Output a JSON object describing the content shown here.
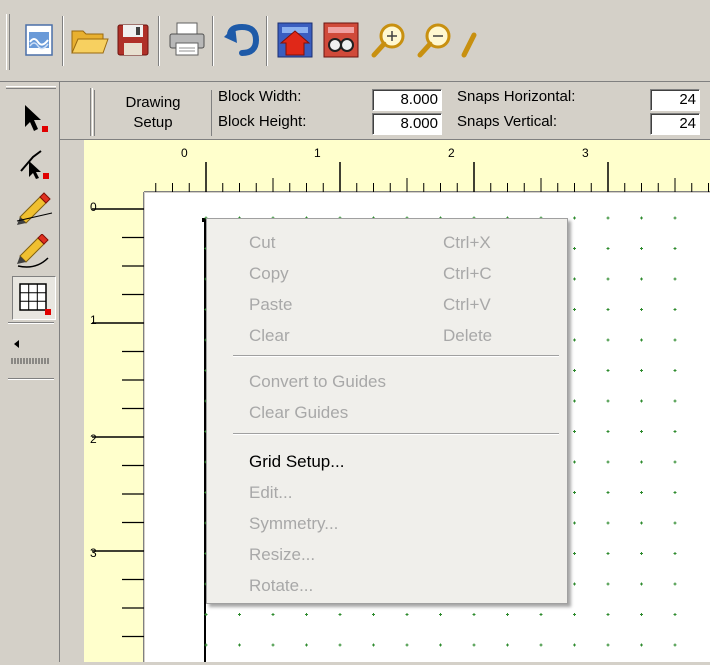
{
  "toolbar": {
    "buttons": [
      {
        "name": "new-document-icon"
      },
      {
        "name": "open-folder-icon"
      },
      {
        "name": "save-disk-icon"
      },
      {
        "name": "print-icon"
      },
      {
        "name": "undo-icon"
      },
      {
        "name": "add-to-sketchbook-icon"
      },
      {
        "name": "view-sketchbook-icon"
      },
      {
        "name": "zoom-in-icon"
      },
      {
        "name": "zoom-out-icon"
      }
    ]
  },
  "palette": {
    "tools": [
      {
        "name": "pick-arrow-tool-icon"
      },
      {
        "name": "shape-node-tool-icon"
      },
      {
        "name": "pencil-line-tool-icon"
      },
      {
        "name": "pencil-curve-tool-icon"
      },
      {
        "name": "grid-tool-icon"
      }
    ]
  },
  "infobar": {
    "setup_label_line1": "Drawing",
    "setup_label_line2": "Setup",
    "block_width_label": "Block Width:",
    "block_width_value": "8.000",
    "block_height_label": "Block Height:",
    "block_height_value": "8.000",
    "snaps_h_label": "Snaps Horizontal:",
    "snaps_h_value": "24",
    "snaps_v_label": "Snaps Vertical:",
    "snaps_v_value": "24"
  },
  "ruler": {
    "h_numbers": [
      "0",
      "1",
      "2",
      "3"
    ],
    "v_numbers": [
      "0",
      "1",
      "2",
      "3"
    ]
  },
  "context_menu": {
    "items": [
      {
        "label": "Cut",
        "shortcut": "Ctrl+X",
        "enabled": false
      },
      {
        "label": "Copy",
        "shortcut": "Ctrl+C",
        "enabled": false
      },
      {
        "label": "Paste",
        "shortcut": "Ctrl+V",
        "enabled": false
      },
      {
        "label": "Clear",
        "shortcut": "Delete",
        "enabled": false
      },
      {
        "label": "Convert to Guides",
        "shortcut": "",
        "enabled": false
      },
      {
        "label": "Clear Guides",
        "shortcut": "",
        "enabled": false
      },
      {
        "label": "Grid Setup...",
        "shortcut": "",
        "enabled": true
      },
      {
        "label": "Edit...",
        "shortcut": "",
        "enabled": false
      },
      {
        "label": "Symmetry...",
        "shortcut": "",
        "enabled": false
      },
      {
        "label": "Resize...",
        "shortcut": "",
        "enabled": false
      },
      {
        "label": "Rotate...",
        "shortcut": "",
        "enabled": false
      }
    ]
  },
  "colors": {
    "grid_dot": "#2e8b2e",
    "ruler_bg": "#ffffcc",
    "selection_marker": "#e00000"
  }
}
